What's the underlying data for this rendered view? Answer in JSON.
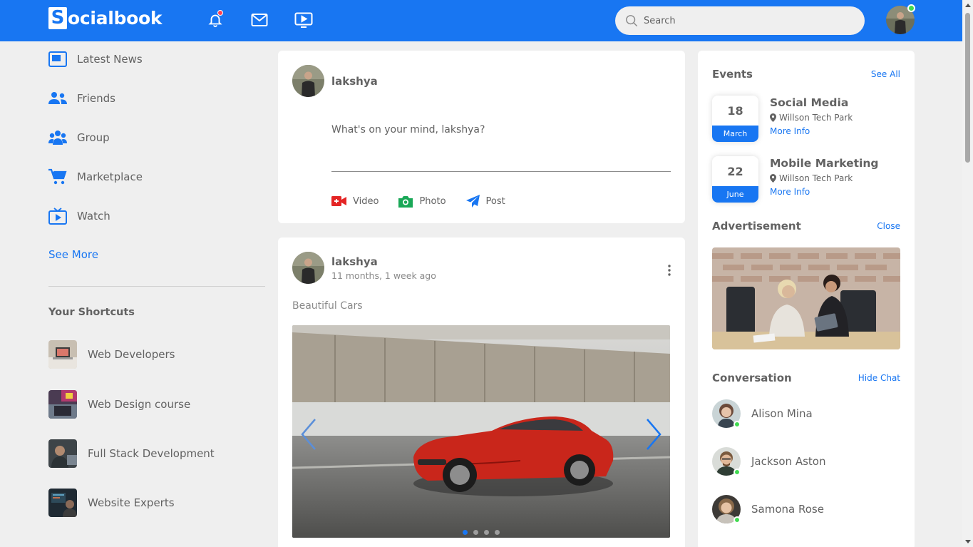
{
  "colors": {
    "brand": "#1876f2",
    "background": "#efefef",
    "text": "#626262",
    "online": "#41db51",
    "notification": "#ff4052"
  },
  "navbar": {
    "logo_letter": "S",
    "logo_rest": "ocialbook",
    "icons": [
      "bell-icon",
      "mail-icon",
      "video-icon"
    ],
    "search": {
      "placeholder": "Search",
      "value": ""
    }
  },
  "sidebar": {
    "links": [
      {
        "label": "Latest News",
        "icon": "news-icon"
      },
      {
        "label": "Friends",
        "icon": "friends-icon"
      },
      {
        "label": "Group",
        "icon": "group-icon"
      },
      {
        "label": "Marketplace",
        "icon": "cart-icon"
      },
      {
        "label": "Watch",
        "icon": "tv-icon"
      }
    ],
    "see_more": "See More",
    "shortcuts_title": "Your Shortcuts",
    "shortcuts": [
      {
        "label": "Web Developers"
      },
      {
        "label": "Web Design course"
      },
      {
        "label": "Full Stack Development"
      },
      {
        "label": "Website Experts"
      }
    ]
  },
  "write_post": {
    "user": "lakshya",
    "placeholder": "What's on your mind, lakshya?",
    "actions": [
      {
        "label": "Video",
        "icon": "video-camera-icon"
      },
      {
        "label": "Photo",
        "icon": "camera-icon"
      },
      {
        "label": "Post",
        "icon": "send-icon"
      }
    ]
  },
  "post": {
    "user": "lakshya",
    "time": "11 months, 1 week ago",
    "text": "Beautiful Cars",
    "carousel": {
      "slides": 4,
      "active": 1
    }
  },
  "events": {
    "title": "Events",
    "link": "See All",
    "items": [
      {
        "day": "18",
        "month": "March",
        "title": "Social Media",
        "location": "Willson Tech Park",
        "more": "More Info"
      },
      {
        "day": "22",
        "month": "June",
        "title": "Mobile Marketing",
        "location": "Willson Tech Park",
        "more": "More Info"
      }
    ]
  },
  "advertisement": {
    "title": "Advertisement",
    "link": "Close"
  },
  "conversation": {
    "title": "Conversation",
    "link": "Hide Chat",
    "people": [
      {
        "name": "Alison Mina"
      },
      {
        "name": "Jackson Aston"
      },
      {
        "name": "Samona Rose"
      }
    ]
  }
}
